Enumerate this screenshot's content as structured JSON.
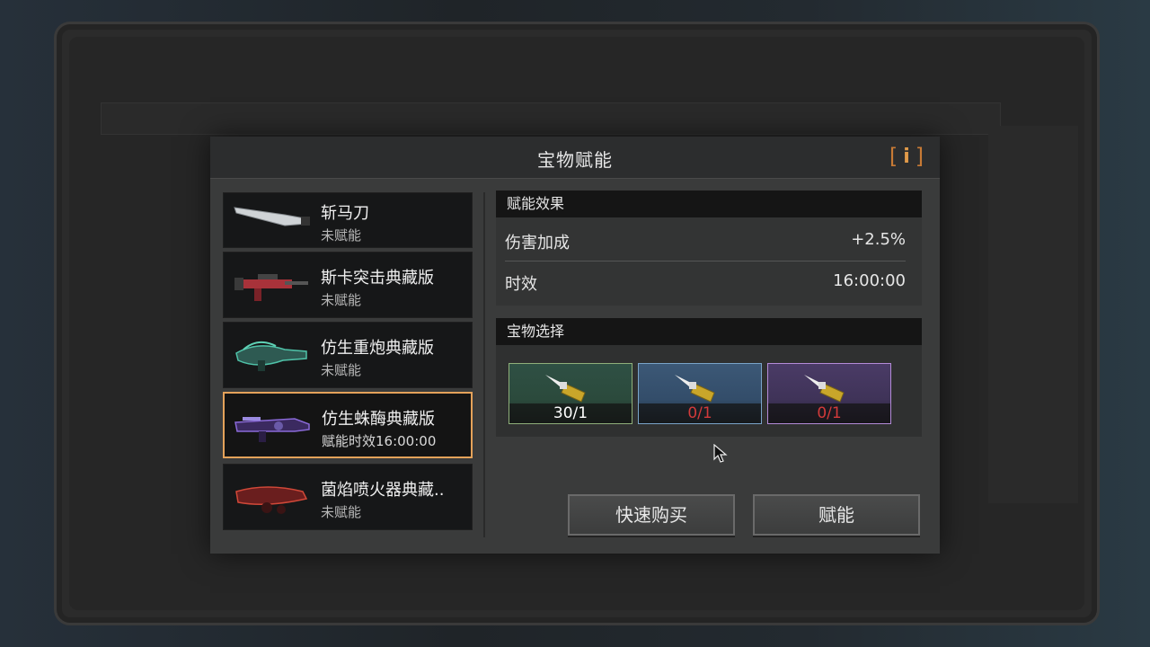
{
  "modal": {
    "title": "宝物赋能",
    "info_icon": "info-icon"
  },
  "weapons": [
    {
      "name": "斩马刀",
      "status": "未赋能",
      "selected": false
    },
    {
      "name": "斯卡突击典藏版",
      "status": "未赋能",
      "selected": false
    },
    {
      "name": "仿生重炮典藏版",
      "status": "未赋能",
      "selected": false
    },
    {
      "name": "仿生蛛酶典藏版",
      "status": "赋能时效16:00:00",
      "selected": true
    },
    {
      "name": "菌焰喷火器典藏..",
      "status": "未赋能",
      "selected": false
    }
  ],
  "effect": {
    "header": "赋能效果",
    "rows": [
      {
        "label": "伤害加成",
        "value": "+2.5%"
      },
      {
        "label": "时效",
        "value": "16:00:00"
      }
    ]
  },
  "treasure": {
    "header": "宝物选择",
    "slots": [
      {
        "rarity": "green",
        "count": "30/1",
        "count_color": "#ffffff"
      },
      {
        "rarity": "blue",
        "count": "0/1",
        "count_color": "#d23a3a"
      },
      {
        "rarity": "purple",
        "count": "0/1",
        "count_color": "#d23a3a"
      }
    ]
  },
  "buttons": {
    "quick_buy": "快速购买",
    "enchant": "赋能"
  },
  "colors": {
    "selected_border": "#e4a25a",
    "info_accent": "#e09a4a"
  }
}
